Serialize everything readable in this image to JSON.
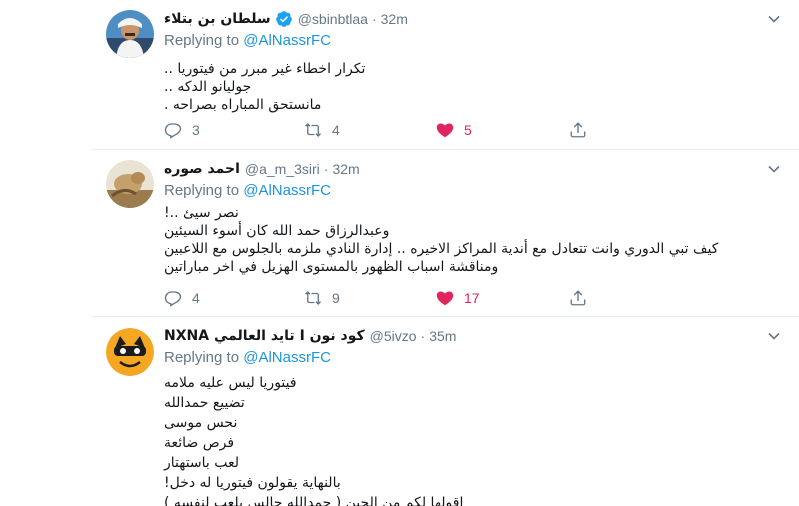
{
  "tweets": [
    {
      "name": "سلطان بن بتلاء",
      "verified": true,
      "handle": "@sbinbtlaa",
      "dot": "·",
      "time": "32m",
      "replying_prefix": "Replying to ",
      "replying_to": "@AlNassrFC",
      "lines": [
        "تكرار اخطاء غير مبرر من فيتوريا ..",
        "جوليانو الدكه ..",
        "مانستحق المباراه بصراحه ."
      ],
      "replies": "3",
      "retweets": "4",
      "likes": "5"
    },
    {
      "name": "احمد صوره",
      "verified": false,
      "handle": "@a_m_3siri",
      "dot": "·",
      "time": "32m",
      "replying_prefix": "Replying to ",
      "replying_to": "@AlNassrFC",
      "lines": [
        "نصر سيئ ..!",
        "وعبدالرزاق حمد الله كان أسوء السيئين",
        "كيف تبي الدوري وانت تتعادل مع أندية المراكز الاخيره .. إدارة النادي ملزمه بالجلوس مع اللاعبين",
        "ومناقشة اسباب الظهور بالمستوى الهزيل في اخر مباراتين"
      ],
      "replies": "4",
      "retweets": "9",
      "likes": "17"
    },
    {
      "name": "NXNA تايد العالمي I كود نون",
      "verified": false,
      "handle": "@5ivzo",
      "dot": "·",
      "time": "35m",
      "replying_prefix": "Replying to ",
      "replying_to": "@AlNassrFC",
      "lines": [
        "فيتوريا ليس عليه ملامه",
        "تضييع حمدالله",
        "نحس موسى",
        "فرص ضائعة",
        "لعب باستهتار",
        "بالنهاية يقولون فيتوريا له دخل!",
        "اقولها لكم من الحين ( حمدالله جالس يلعب لنفسه )"
      ]
    }
  ],
  "colors": {
    "accent": "#1b95e0",
    "like": "#e0245e",
    "muted": "#657786",
    "text": "#14171a",
    "divider": "#e6ecf0"
  },
  "icons": {
    "reply": "reply-icon",
    "retweet": "retweet-icon",
    "like": "heart-icon",
    "share": "share-icon",
    "caret": "chevron-down-icon",
    "verified": "verified-badge-icon"
  }
}
